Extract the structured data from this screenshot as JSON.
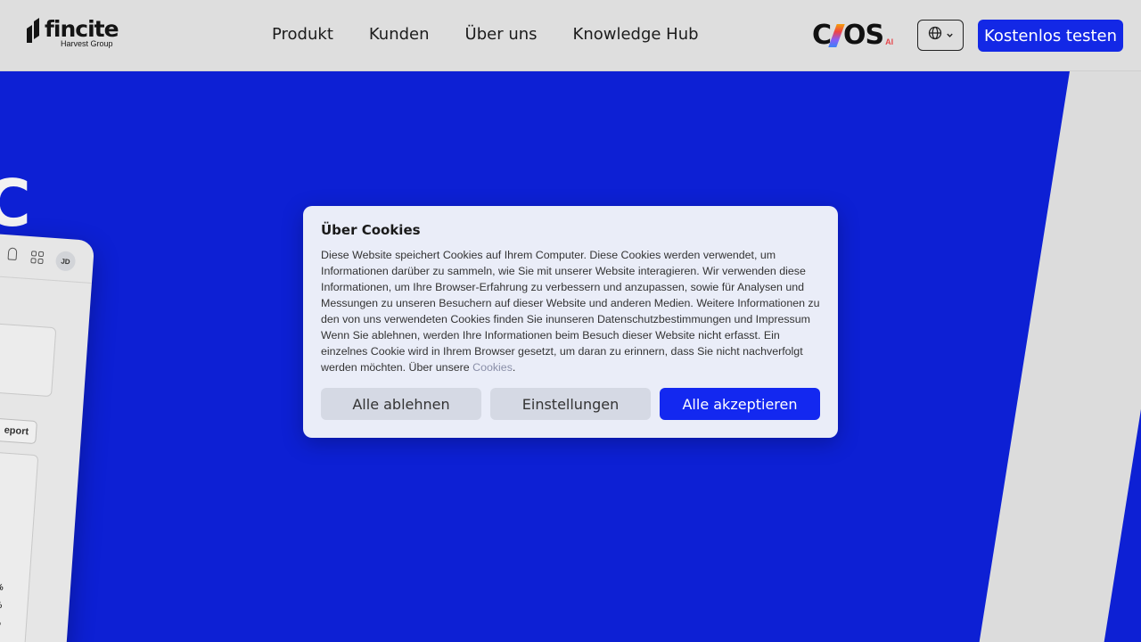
{
  "header": {
    "logo_word": "fincite",
    "logo_sub": "Harvest Group",
    "nav": [
      "Produkt",
      "Kunden",
      "Über uns",
      "Knowledge Hub"
    ],
    "cios_left": "C",
    "cios_right": "OS",
    "cios_ai": "AI",
    "cta_label": "Kostenlos testen"
  },
  "hero": {
    "big_letter": "C",
    "mock": {
      "avatar": "JD",
      "report_label": "eport",
      "pct": [
        "%",
        "%",
        "%"
      ]
    }
  },
  "cookie_modal": {
    "title": "Über Cookies",
    "body": "Diese Website speichert Cookies auf Ihrem Computer. Diese Cookies werden verwendet, um Informationen darüber zu sammeln, wie Sie mit unserer Website interagieren. Wir verwenden diese Informationen, um Ihre Browser-Erfahrung zu verbessern und anzupassen, sowie für Analysen und Messungen zu unseren Besuchern auf dieser Website und anderen Medien. Weitere Informationen zu den von uns verwendeten Cookies finden Sie inunseren Datenschutzbestimmungen und Impressum Wenn Sie ablehnen, werden Ihre Informationen beim Besuch dieser Website nicht erfasst. Ein einzelnes Cookie wird in Ihrem Browser gesetzt, um daran zu erinnern, dass Sie nicht nachverfolgt werden möchten. Über unsere ",
    "link": "Cookies",
    "after_link": ".",
    "buttons": {
      "reject": "Alle ablehnen",
      "settings": "Einstellungen",
      "accept": "Alle akzeptieren"
    }
  },
  "colors": {
    "brand_blue": "#1328e6",
    "hero_bg": "#0d20d4",
    "modal_bg": "#eaedf8"
  },
  "icons": [
    "globe-icon",
    "chevron-down-icon",
    "grid-icon",
    "bell-icon"
  ]
}
